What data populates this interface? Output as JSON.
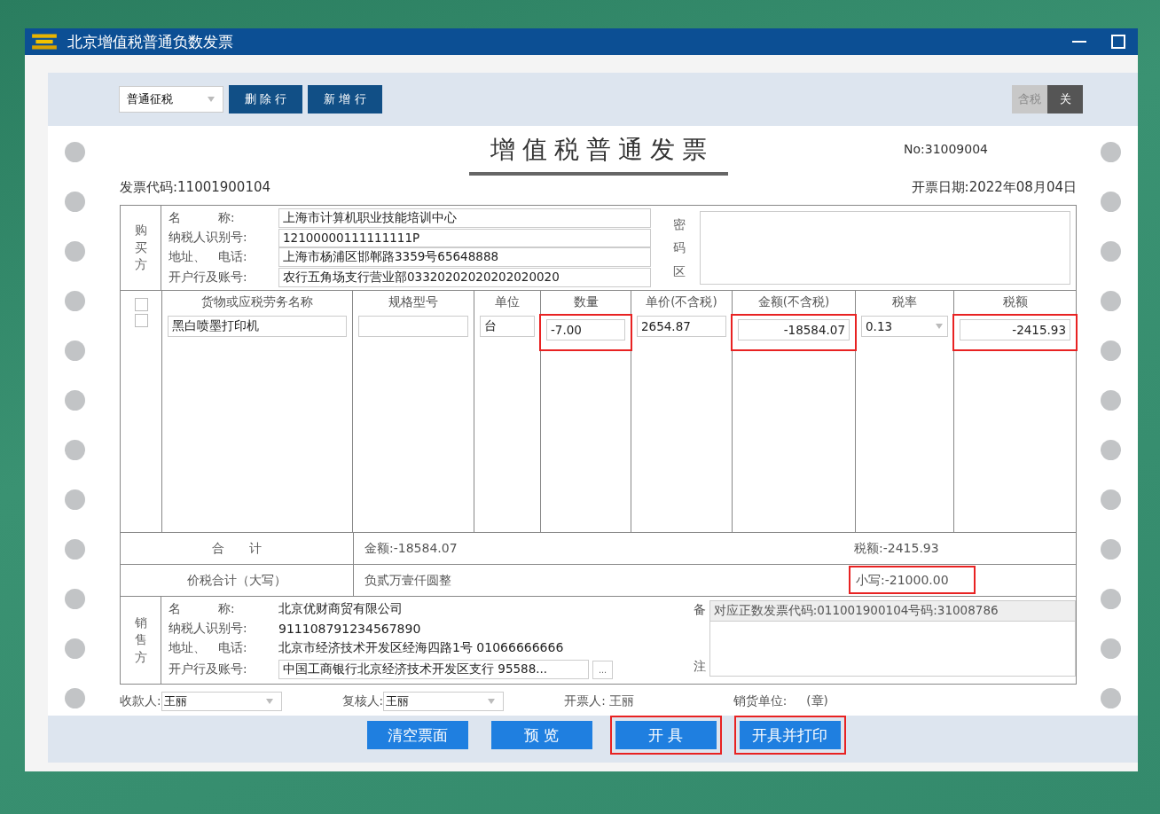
{
  "window": {
    "title": "北京增值税普通负数发票"
  },
  "toolbar": {
    "tax_type": "普通征税",
    "buttons": [
      "删 除 行",
      "新 增 行"
    ],
    "tax_toggle": [
      {
        "label": "含税",
        "selected": false
      },
      {
        "label": "关",
        "selected": true
      }
    ]
  },
  "invoice": {
    "title": "增值税普通发票",
    "number": "No:31009004",
    "code": "发票代码:11001900104",
    "date": "开票日期:2022年08月04日",
    "buyer": {
      "label": "购买方",
      "fields": [
        {
          "label": "名　　　称:",
          "value": "上海市计算机职业技能培训中心"
        },
        {
          "label": "纳税人识别号:",
          "value": "12100000111111111P"
        },
        {
          "label": "地址、　电话:",
          "value": "上海市杨浦区邯郸路3359号65648888"
        },
        {
          "label": "开户行及账号:",
          "value": "农行五角场支行营业部03320202020202020020"
        }
      ]
    },
    "cipher_label": "密码区",
    "items": {
      "header_checkbox": {
        "checked": false
      },
      "columns": [
        "货物或应税劳务名称",
        "规格型号",
        "单位",
        "数量",
        "单价(不含税)",
        "金额(不含税)",
        "税率",
        "税额"
      ],
      "rows": [
        {
          "checked": false,
          "cells": [
            {
              "kind": "text",
              "value": "黑白喷墨打印机",
              "highlighted": false
            },
            {
              "kind": "text",
              "highlighted": false
            },
            {
              "kind": "text",
              "value": "台",
              "highlighted": false
            },
            {
              "kind": "text",
              "value": "-7.00",
              "highlighted": true
            },
            {
              "kind": "text",
              "value": "2654.87",
              "highlighted": false
            },
            {
              "kind": "number",
              "value": "-18584.07",
              "highlighted": true
            },
            {
              "kind": "dropdown",
              "value": "0.13",
              "highlighted": false
            },
            {
              "kind": "number",
              "value": "-2415.93",
              "highlighted": true
            }
          ]
        }
      ]
    },
    "total": {
      "label": "合　　计",
      "amount": "金额:-18584.07",
      "tax": "税额:-2415.93"
    },
    "grand_total": {
      "label": "价税合计（大写）",
      "words": "负贰万壹仟圆整",
      "figure": "小写:-21000.00",
      "highlighted": true
    },
    "seller": {
      "label": "销售方",
      "fields": [
        {
          "kind": "text",
          "label": "名　　　称:",
          "value": "北京优财商贸有限公司"
        },
        {
          "kind": "text",
          "label": "纳税人识别号:",
          "value": "911108791234567890"
        },
        {
          "kind": "text",
          "label": "地址、　电话:",
          "value": "北京市经济技术开发区经海四路1号 01066666666"
        },
        {
          "kind": "field",
          "label": "开户行及账号:",
          "value": "中国工商银行北京经济技术开发区支行 95588...",
          "button": "..."
        }
      ]
    },
    "remarks": {
      "label_top": "备",
      "label_bottom": "注",
      "value": "对应正数发票代码:011001900104号码:31008786"
    },
    "signatures": [
      {
        "kind": "dropdown",
        "label": "收款人:",
        "value": "王丽"
      },
      {
        "kind": "dropdown",
        "label": "复核人:",
        "value": "王丽"
      },
      {
        "kind": "text",
        "label": "开票人:",
        "value": "王丽"
      },
      {
        "kind": "text",
        "label": "销货单位:",
        "value": "(章)"
      }
    ]
  },
  "actions": [
    {
      "label": "清空票面",
      "highlighted": false
    },
    {
      "label": "预 览",
      "highlighted": false
    },
    {
      "label": "开 具",
      "highlighted": true
    },
    {
      "label": "开具并打印",
      "highlighted": true
    }
  ]
}
